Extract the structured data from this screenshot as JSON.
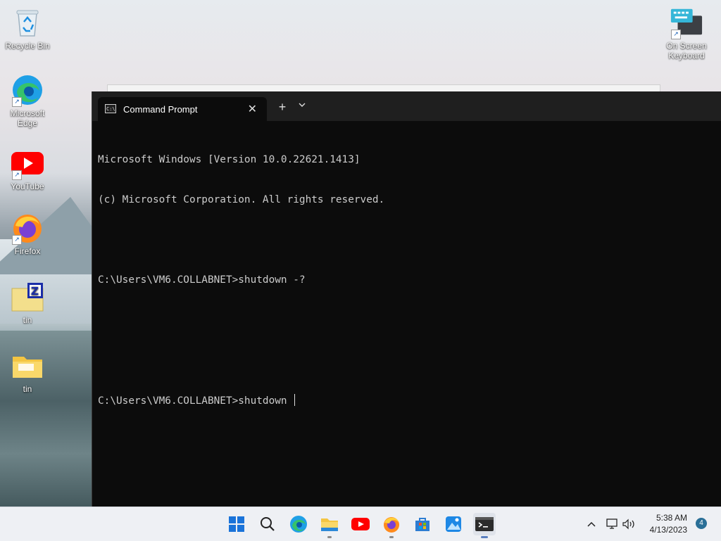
{
  "desktop": {
    "icons": [
      {
        "label": "Recycle Bin",
        "icon": "recycle-bin-icon"
      },
      {
        "label": "Microsoft Edge",
        "icon": "edge-icon"
      },
      {
        "label": "YouTube",
        "icon": "youtube-icon"
      },
      {
        "label": "Firefox",
        "icon": "firefox-icon"
      },
      {
        "label": "tin",
        "icon": "zip-folder-icon"
      },
      {
        "label": "tin",
        "icon": "folder-icon"
      },
      {
        "label": "On Screen Keyboard",
        "icon": "keyboard-icon"
      }
    ]
  },
  "terminal": {
    "tab_title": "Command Prompt",
    "new_tab_symbol": "+",
    "lines": [
      "Microsoft Windows [Version 10.0.22621.1413]",
      "(c) Microsoft Corporation. All rights reserved.",
      "",
      "C:\\Users\\VM6.COLLABNET>shutdown -?",
      "",
      "",
      "C:\\Users\\VM6.COLLABNET>shutdown "
    ]
  },
  "taskbar": {
    "apps": [
      "start-icon",
      "search-icon",
      "edge-icon",
      "file-explorer-icon",
      "youtube-icon",
      "firefox-icon",
      "store-icon",
      "photos-icon",
      "terminal-icon"
    ],
    "clock_time": "5:38 AM",
    "clock_date": "4/13/2023",
    "notification_count": "4"
  },
  "colors": {
    "terminal_bg": "#0c0c0c",
    "terminal_text": "#cccccc",
    "taskbar_bg": "#eef0f4"
  }
}
